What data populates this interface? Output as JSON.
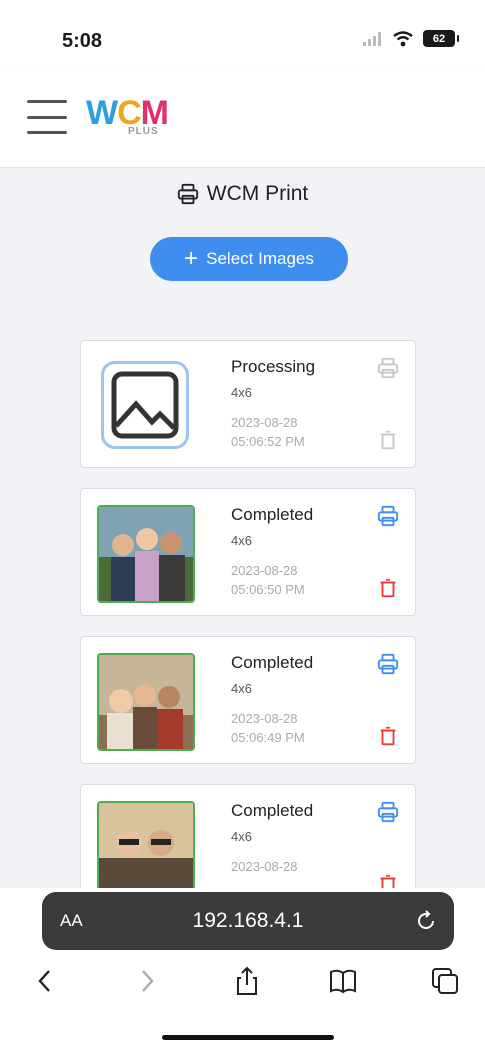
{
  "status_bar": {
    "time": "5:08",
    "battery": "62"
  },
  "header": {
    "logo_w": "W",
    "logo_c": "C",
    "logo_m": "M",
    "logo_sub": "PLUS"
  },
  "page": {
    "title": "WCM Print",
    "select_button": "Select Images"
  },
  "jobs": [
    {
      "status": "Processing",
      "size": "4x6",
      "date": "2023-08-28",
      "time": "05:06:52 PM",
      "thumbnail": "image-placeholder"
    },
    {
      "status": "Completed",
      "size": "4x6",
      "date": "2023-08-28",
      "time": "05:06:50 PM",
      "thumbnail": "photo"
    },
    {
      "status": "Completed",
      "size": "4x6",
      "date": "2023-08-28",
      "time": "05:06:49 PM",
      "thumbnail": "photo"
    },
    {
      "status": "Completed",
      "size": "4x6",
      "date": "2023-08-28",
      "time": "",
      "thumbnail": "photo"
    }
  ],
  "browser": {
    "aa": "AA",
    "url": "192.168.4.1"
  },
  "colors": {
    "accent": "#3e8ef0",
    "delete": "#e53935",
    "photo_border": "#4cae4f"
  }
}
